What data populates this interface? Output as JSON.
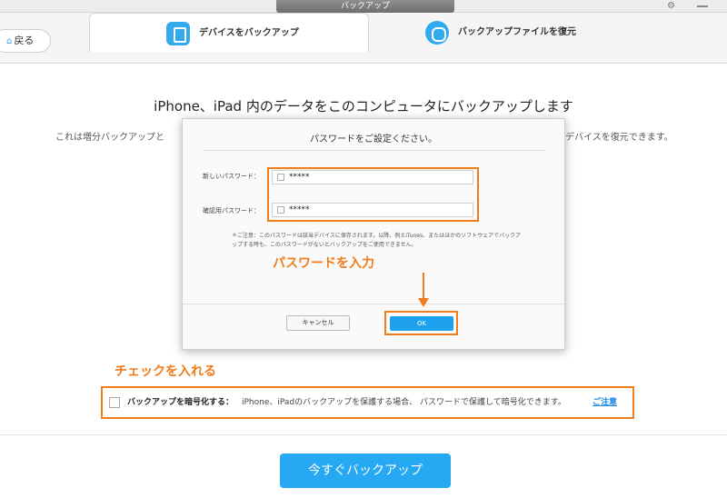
{
  "window": {
    "title": "バックアップ",
    "gear_icon": "gear-icon"
  },
  "nav": {
    "back_label": "戻る",
    "tabs": [
      {
        "label": "デバイスをバックアップ",
        "icon": "device-backup-icon",
        "active": true
      },
      {
        "label": "バックアップファイルを復元",
        "icon": "restore-icon",
        "active": false
      }
    ]
  },
  "main": {
    "heading": "iPhone、iPad 内のデータをこのコンピュータにバックアップします",
    "desc_left": "これは増分バックアップと",
    "desc_right": "デバイスを復元できます。"
  },
  "dialog": {
    "title": "パスワードをご設定ください。",
    "new_password_label": "新しいパスワード：",
    "new_password_value": "*****",
    "confirm_password_label": "確認用パスワード：",
    "confirm_password_value": "*****",
    "note": "＊ご注意：このパスワードは該当デバイスに保存されます。以降、例えiTunes、またはほかのソフトウェアでバックアップする時も、このパスワードがないとバックアップをご使用できません。",
    "cancel_label": "キャンセル",
    "ok_label": "OK"
  },
  "annotations": {
    "enter_password": "パスワードを入力",
    "check_this": "チェックを入れる",
    "color": "#f07c1a"
  },
  "encrypt": {
    "label": "バックアップを暗号化する：",
    "description": "iPhone、iPadのバックアップを保護する場合、 パスワードで保護して暗号化できます。",
    "link": "ご注意",
    "checked": false
  },
  "backup_button": "今すぐバックアップ",
  "colors": {
    "accent": "#27a8f2",
    "annotation": "#f07c1a"
  }
}
